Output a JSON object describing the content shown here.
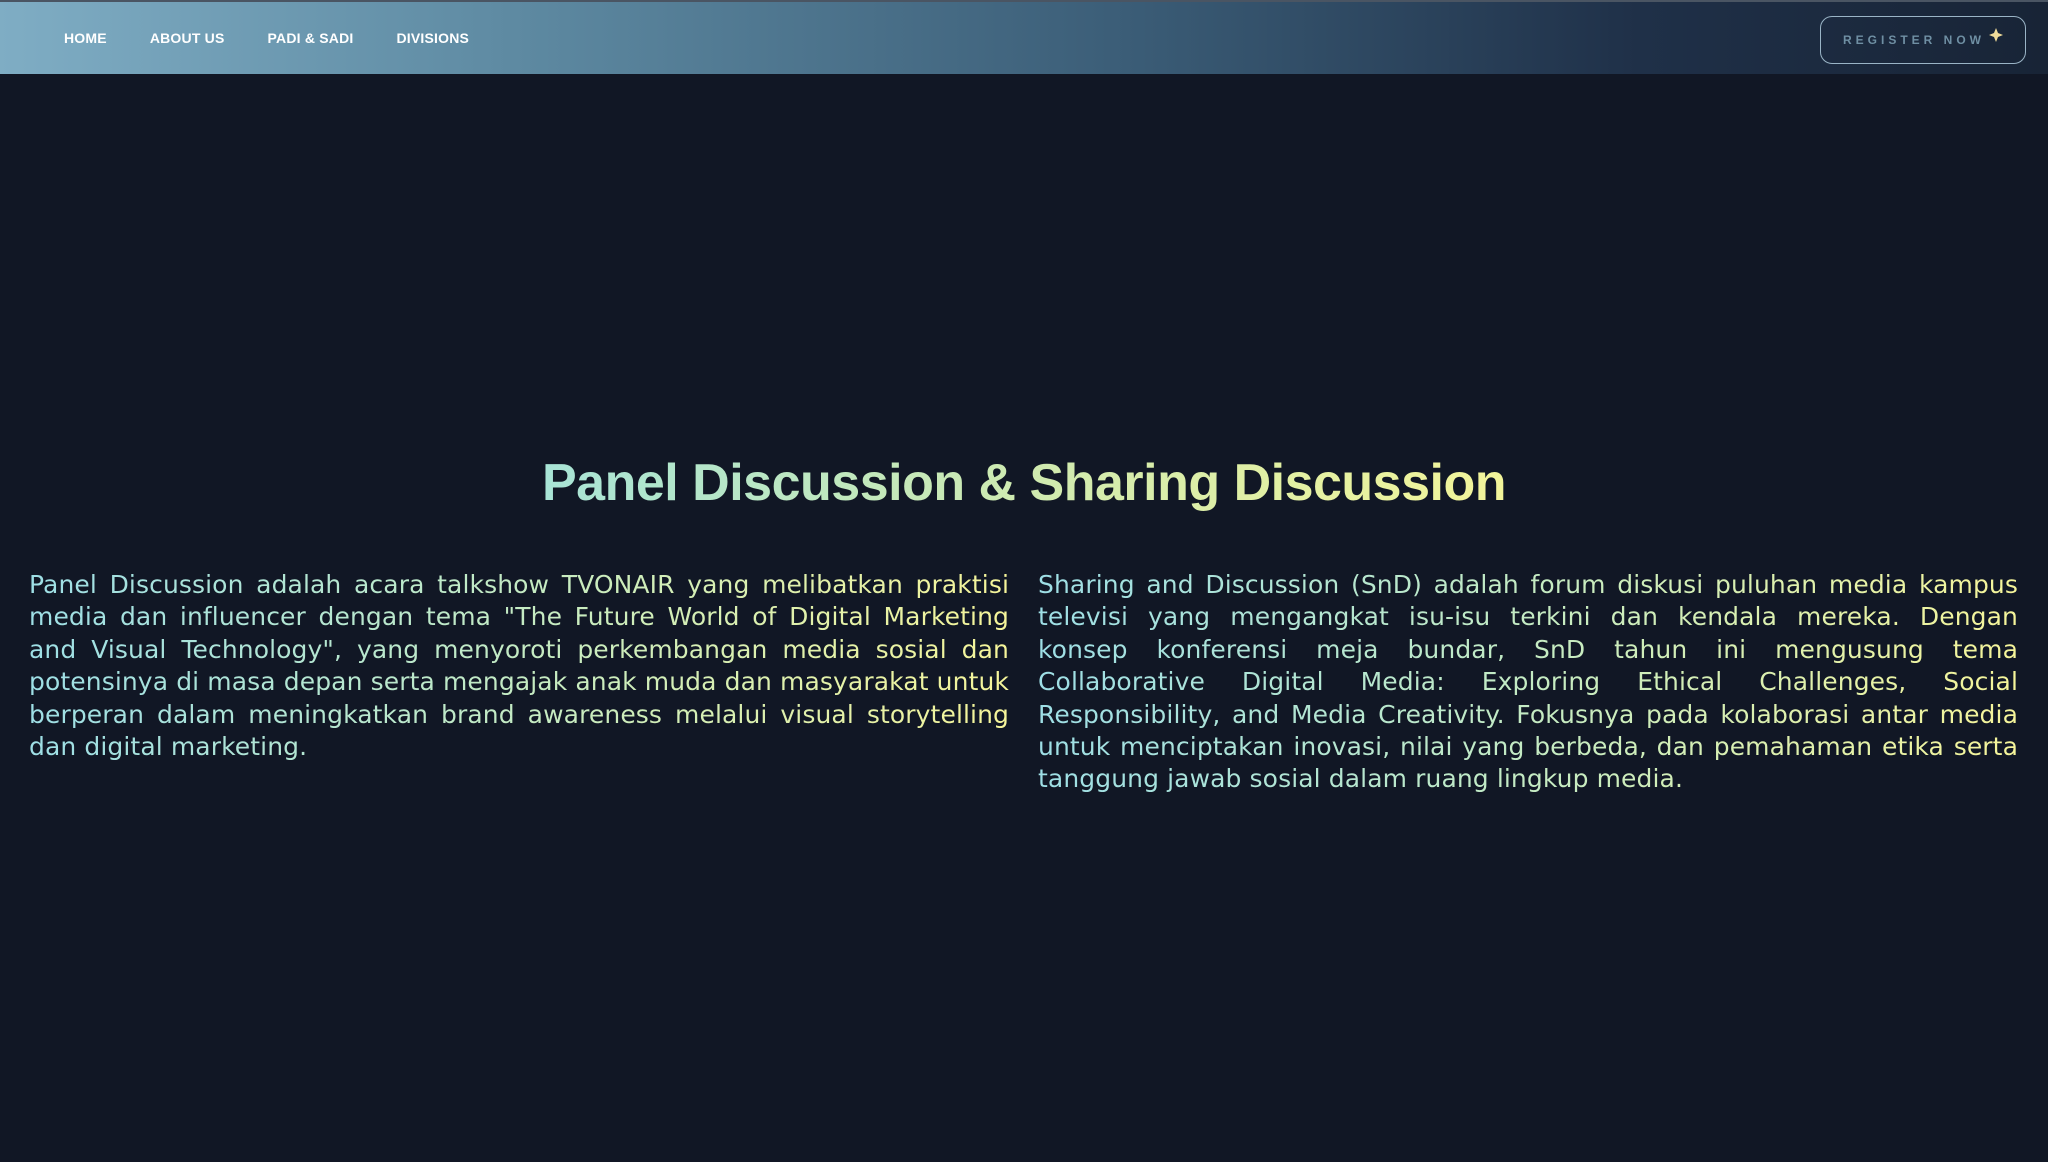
{
  "nav": {
    "links": [
      "HOME",
      "ABOUT US",
      "PADI & SADI",
      "DIVISIONS"
    ],
    "register_label": "REGISTER NOW",
    "register_icon": "spark-icon"
  },
  "main": {
    "title": "Panel Discussion & Sharing Discussion",
    "left_paragraph": "Panel Discussion adalah acara talkshow TVONAIR yang melibatkan praktisi media dan influencer dengan tema \"The Future World of Digital Marketing and Visual Technology\", yang menyoroti perkembangan media sosial dan potensinya di masa depan serta mengajak anak muda dan masyarakat untuk berperan dalam meningkatkan brand awareness melalui visual storytelling dan digital marketing.",
    "right_paragraph": "Sharing and Discussion (SnD) adalah forum diskusi puluhan media kampus televisi yang mengangkat isu-isu terkini dan kendala mereka. Dengan konsep konferensi meja bundar, SnD tahun ini mengusung tema Collaborative Digital Media: Exploring Ethical Challenges, Social Responsibility, and Media Creativity. Fokusnya pada kolaborasi antar media untuk menciptakan inovasi, nilai yang berbeda, dan pemahaman etika serta tanggung jawab sosial dalam ruang lingkup media."
  },
  "colors": {
    "background": "#111725",
    "nav_gradient_start": "#7fadc4",
    "nav_gradient_end": "#182436",
    "text_gradient_start": "#9edfe6",
    "text_gradient_end": "#f6f59a"
  }
}
